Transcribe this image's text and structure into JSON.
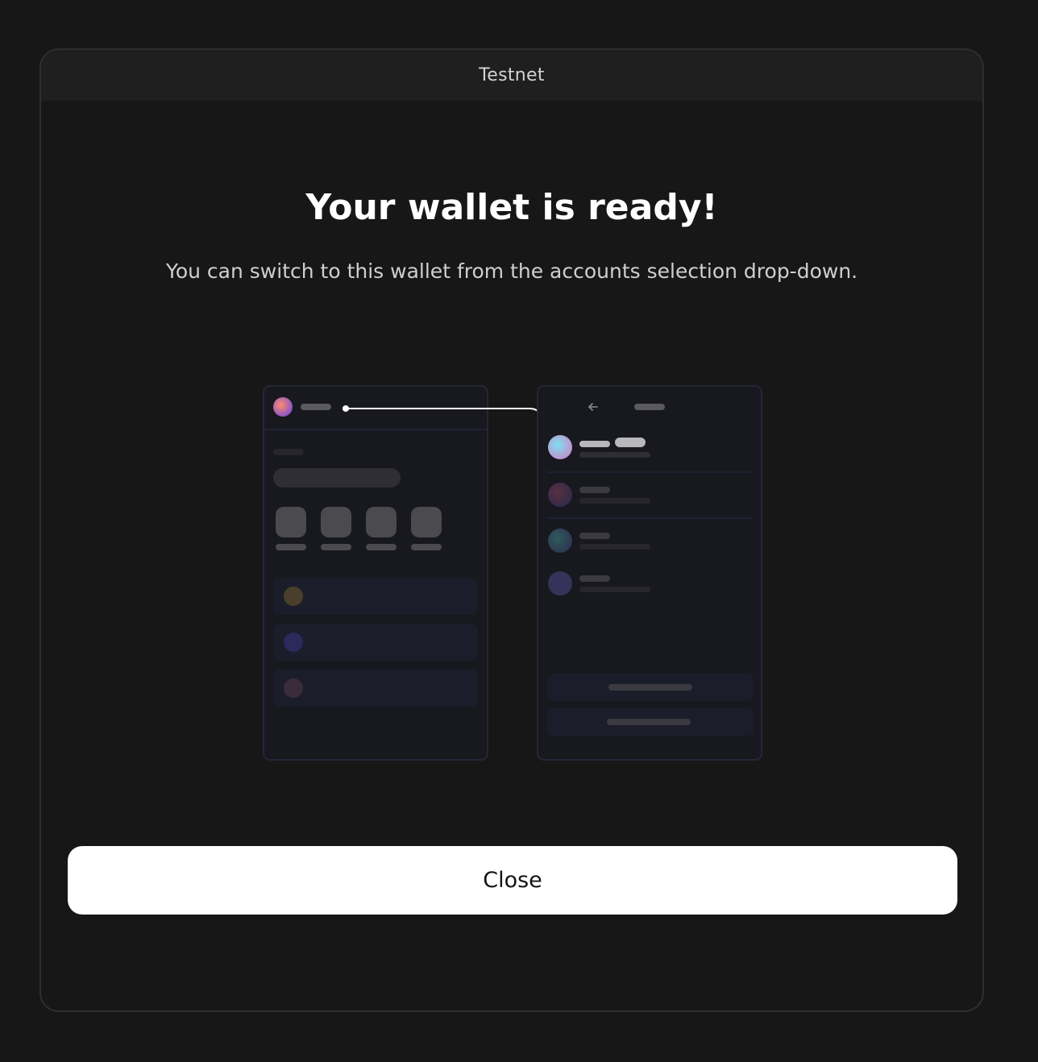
{
  "header": {
    "network_label": "Testnet"
  },
  "main": {
    "title": "Your wallet is ready!",
    "subtitle": "You can switch to this wallet from the accounts selection drop-down.",
    "close_label": "Close"
  },
  "colors": {
    "background": "#171717",
    "header_bar": "#1f1f1f",
    "button_bg": "#ffffff",
    "button_text": "#141414",
    "illustration_panel": "#18181f"
  },
  "illustration": {
    "icons": [
      "account-avatar-icon",
      "arrow-left-icon",
      "connector-arrow-icon"
    ]
  }
}
